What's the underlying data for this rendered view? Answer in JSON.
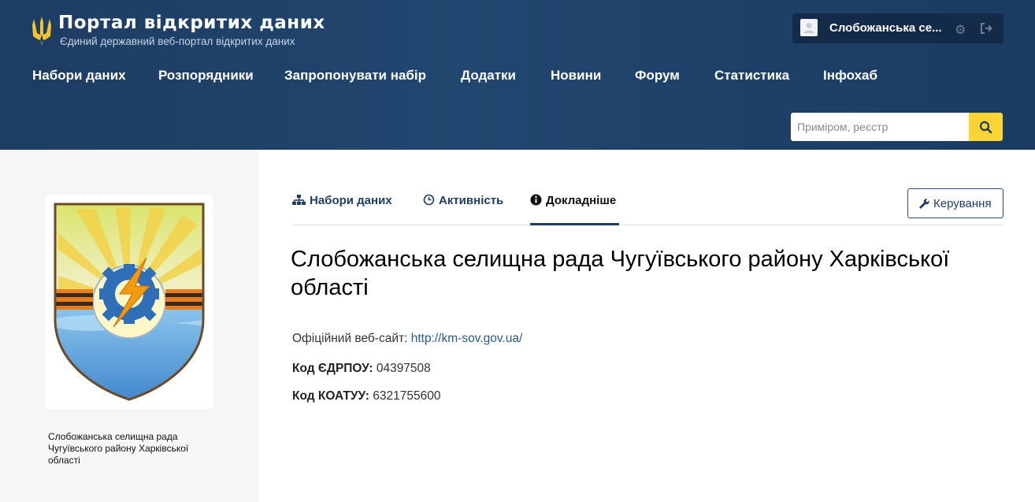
{
  "header": {
    "brand_title": "Портал відкритих даних",
    "brand_subtitle": "Єдиний державний веб-портал відкритих даних",
    "user_name": "Слобожанська се...",
    "nav": [
      "Набори даних",
      "Розпорядники",
      "Запропонувати набір",
      "Додатки",
      "Новини",
      "Форум",
      "Статистика",
      "Інфохаб"
    ],
    "search_placeholder": "Приміром, реєстр",
    "icons": [
      "trident-icon",
      "user-avatar-icon",
      "gear-icon",
      "logout-icon",
      "search-icon"
    ]
  },
  "sidebar": {
    "caption": "Слобожанська селищна рада Чугуївського району Харківської області"
  },
  "tabs": {
    "datasets": "Набори даних",
    "activity": "Активність",
    "details": "Докладніше",
    "manage": "Керування"
  },
  "org": {
    "title": "Слобожанська селищна рада Чугуївського району Харківської області",
    "website_label": "Офіційний веб-сайт:",
    "website_url": "http://km-sov.gov.ua/",
    "edrpou_label": "Код ЄДРПОУ:",
    "edrpou": "04397508",
    "koatuu_label": "Код КОАТУУ:",
    "koatuu": "6321755600"
  },
  "colors": {
    "header_bg": "#1f4169",
    "accent": "#1f3d66",
    "search_button": "#fcd535",
    "sidebar_bg": "#f6f6f6"
  }
}
